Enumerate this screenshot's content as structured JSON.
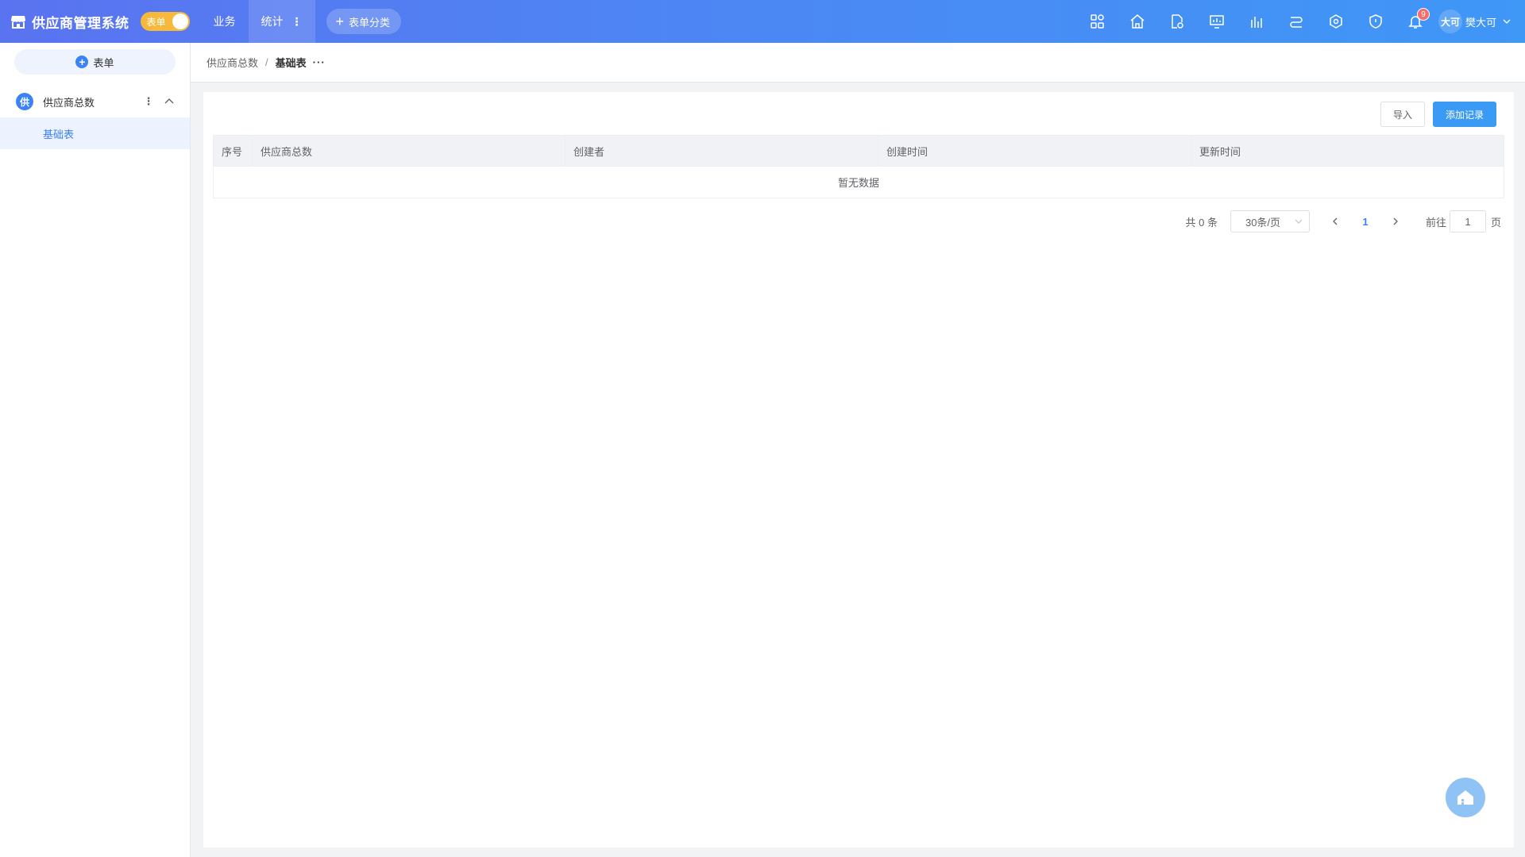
{
  "app": {
    "title": "供应商管理系统",
    "mode_label": "表单"
  },
  "nav": {
    "items": [
      {
        "label": "业务"
      },
      {
        "label": "统计"
      }
    ],
    "add_category_label": "表单分类"
  },
  "top_icons": [
    "apps-icon",
    "home-icon",
    "document-settings-icon",
    "monitor-chart-icon",
    "bar-chart-icon",
    "data-flow-icon",
    "network-icon",
    "shield-icon",
    "bell-icon"
  ],
  "notifications": {
    "count": "9"
  },
  "user": {
    "avatar_text": "大可",
    "name": "樊大可"
  },
  "sidebar": {
    "new_form_label": "表单",
    "group": {
      "badge": "供",
      "label": "供应商总数"
    },
    "sub_item": "基础表"
  },
  "breadcrumb": {
    "parent": "供应商总数",
    "separator": "/",
    "current": "基础表",
    "more": "···"
  },
  "toolbar": {
    "import_label": "导入",
    "add_label": "添加记录"
  },
  "table": {
    "columns": [
      "序号",
      "供应商总数",
      "创建者",
      "创建时间",
      "更新时间"
    ],
    "empty_text": "暂无数据"
  },
  "pagination": {
    "total": "共 0 条",
    "page_size": "30条/页",
    "current_page": "1",
    "goto_label": "前往",
    "goto_value": "1",
    "page_unit": "页"
  },
  "colors": {
    "accent": "#3b82f6",
    "topbar_start": "#5a73f0",
    "topbar_end": "#3f97f6",
    "switch": "#f6b93b",
    "badge": "#f56c6c"
  }
}
